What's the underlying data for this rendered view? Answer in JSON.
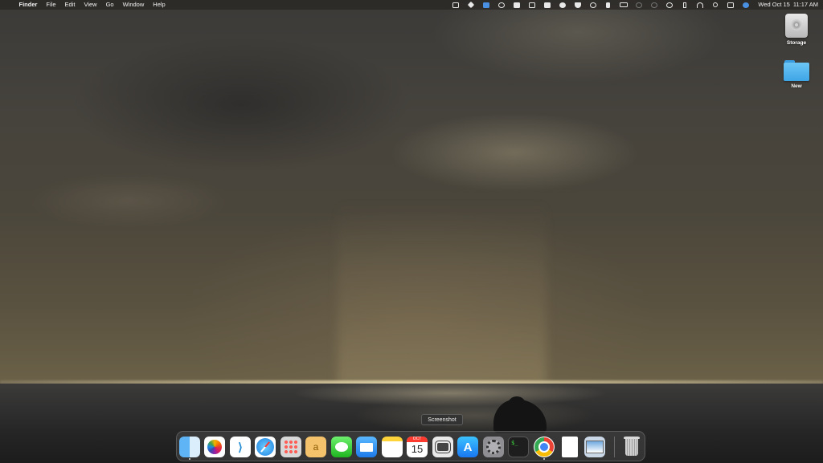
{
  "menubar": {
    "apple_glyph": "",
    "app_name": "Finder",
    "menus": [
      "File",
      "Edit",
      "View",
      "Go",
      "Window",
      "Help"
    ],
    "status_icons": [
      "input-source-icon",
      "sparkle-icon",
      "notes-widget-icon",
      "creative-cloud-icon",
      "bold-text-icon",
      "image-icon",
      "display-icon",
      "chat-icon",
      "heart-shield-icon",
      "time-machine-icon",
      "volume-icon",
      "battery-icon",
      "dim-circle-icon-1",
      "dim-circle-icon-2",
      "info-icon",
      "bluetooth-icon",
      "wifi-icon",
      "spotlight-icon",
      "control-center-icon",
      "siri-icon"
    ],
    "clock_date": "Wed Oct 15",
    "clock_time": "11:17 AM"
  },
  "desktop": {
    "icons": [
      {
        "label": "Storage",
        "type": "drive-icon"
      },
      {
        "label": "New",
        "type": "folder-icon"
      }
    ]
  },
  "tooltip": {
    "text": "Screenshot"
  },
  "dock": {
    "apps": [
      {
        "name": "Finder",
        "icon": "finder-icon",
        "running": true
      },
      {
        "name": "Photos",
        "icon": "photos-icon",
        "running": false
      },
      {
        "name": "Visual Studio Code",
        "icon": "vscode-icon",
        "running": false
      },
      {
        "name": "Safari",
        "icon": "safari-icon",
        "running": false
      },
      {
        "name": "Launchpad",
        "icon": "launchpad-icon",
        "running": false
      },
      {
        "name": "Amazon",
        "icon": "amazon-icon",
        "running": false
      },
      {
        "name": "Messages",
        "icon": "messages-icon",
        "running": false
      },
      {
        "name": "Mail",
        "icon": "mail-icon",
        "running": false
      },
      {
        "name": "Notes",
        "icon": "notes-icon",
        "running": false
      },
      {
        "name": "Calendar",
        "icon": "calendar-icon",
        "running": false,
        "month": "OCT",
        "day": "15"
      },
      {
        "name": "Screenshot",
        "icon": "screenshot-icon",
        "running": false
      },
      {
        "name": "App Store",
        "icon": "app-store-icon",
        "running": false
      },
      {
        "name": "System Settings",
        "icon": "settings-icon",
        "running": false
      },
      {
        "name": "Terminal",
        "icon": "terminal-icon",
        "running": false,
        "prompt": "$_"
      },
      {
        "name": "Google Chrome",
        "icon": "chrome-icon",
        "running": true
      },
      {
        "name": "Document",
        "icon": "document-icon",
        "running": false
      },
      {
        "name": "Preview",
        "icon": "preview-icon",
        "running": false
      },
      {
        "name": "Trash",
        "icon": "trash-icon",
        "running": false
      }
    ]
  },
  "colors": {
    "menubar_bg": "#28261f",
    "folder_blue": "#3ea5e6",
    "accent_blue": "#1d7ae8"
  }
}
